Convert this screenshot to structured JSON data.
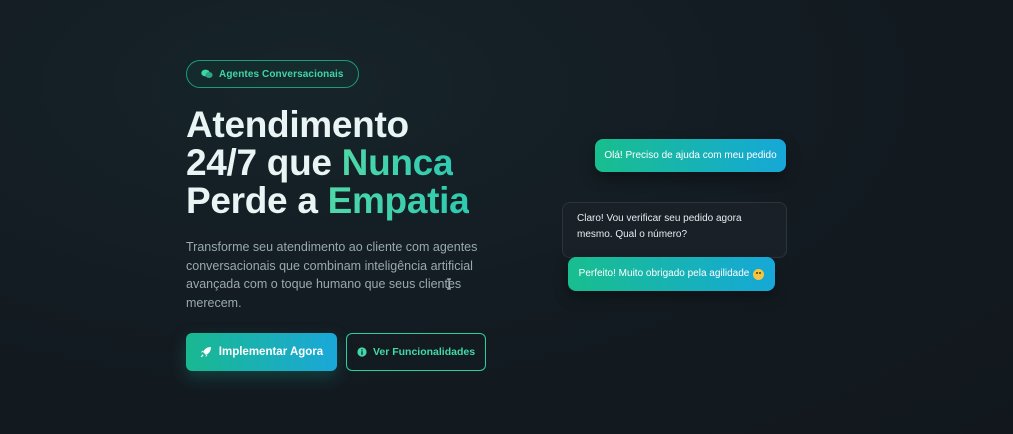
{
  "hero": {
    "badge": {
      "label": "Agentes Conversacionais",
      "icon": "chat-bubbles-icon"
    },
    "title": {
      "line1": "Atendimento",
      "line2_plain": "24/7 que ",
      "line2_accent": "Nunca",
      "line3_plain": "Perde a ",
      "line3_accent": "Empatia"
    },
    "subtitle": "Transforme seu atendimento ao cliente com agentes conversacionais que combinam inteligência artificial avançada com o toque humano que seus clientes merecem.",
    "primary_button": {
      "label": "Implementar Agora",
      "icon": "rocket-icon"
    },
    "secondary_button": {
      "label": "Ver Funcionalidades",
      "icon": "info-circle-icon"
    }
  },
  "chat": {
    "messages": [
      {
        "from": "user",
        "text": "Olá! Preciso de ajuda com meu pedido"
      },
      {
        "from": "agent",
        "text": "Claro! Vou verificar seu pedido agora mesmo. Qual o número?"
      },
      {
        "from": "user",
        "text": "Perfeito! Muito obrigado pela agilidade",
        "emoji": "smiling-face-icon"
      }
    ]
  },
  "colors": {
    "accent_green": "#2ccf9b",
    "accent_blue": "#1aa8d9",
    "background": "#131c22"
  }
}
